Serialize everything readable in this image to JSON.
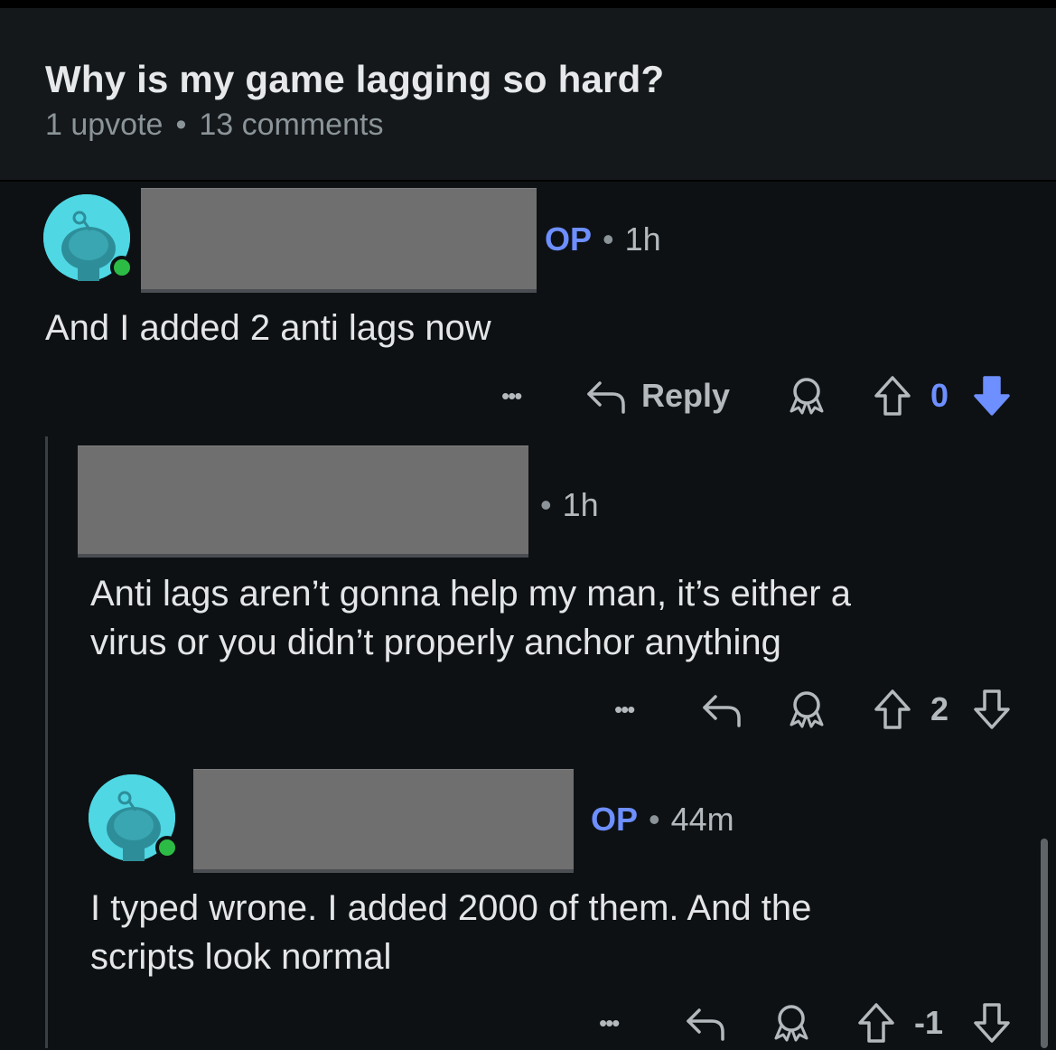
{
  "post": {
    "title": "Why is my game lagging so hard?",
    "upvotes": "1 upvote",
    "separator": "•",
    "comments": "13 comments"
  },
  "comments": [
    {
      "op_tag": "OP",
      "separator": "•",
      "time": "1h",
      "text": "And I added 2 anti lags now",
      "more": "•••",
      "reply_label": "Reply",
      "vote_count": "0",
      "vote_state": "downvoted",
      "vote_color": "#6d8fff"
    },
    {
      "separator": "•",
      "time": "1h",
      "text_lines": [
        "Anti lags aren’t gonna help my man, it’s either a",
        "virus or you didn’t properly anchor anything"
      ],
      "more": "•••",
      "vote_count": "2"
    },
    {
      "op_tag": "OP",
      "separator": "•",
      "time": "44m",
      "text_lines": [
        "I typed wrone. I added 2000 of them. And the",
        "scripts look normal"
      ],
      "more": "•••",
      "vote_count": "-1"
    }
  ],
  "colors": {
    "background": "#0e1113",
    "accent": "#6d8fff",
    "avatar": "#4fd7e4",
    "online": "#2cbc45"
  }
}
